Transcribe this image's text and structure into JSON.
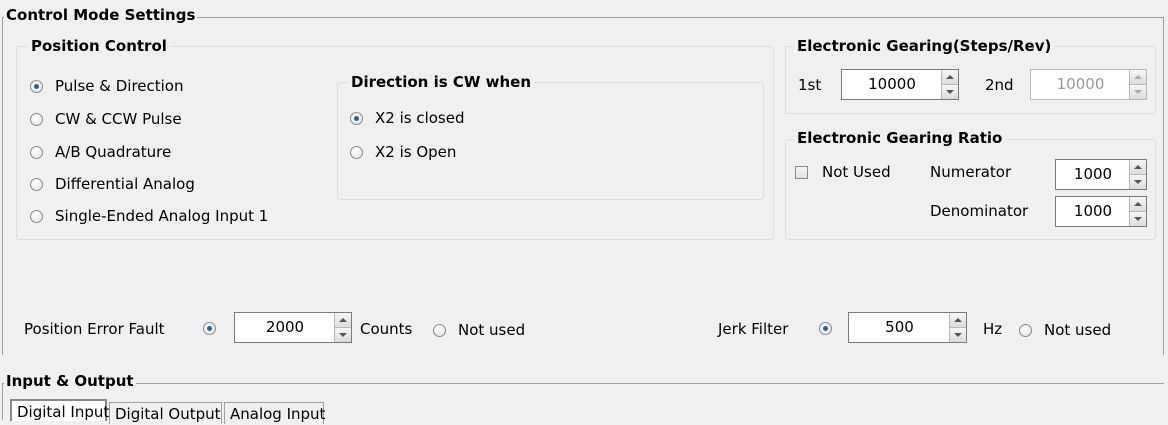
{
  "control_mode": {
    "title": "Control Mode Settings",
    "position_control": {
      "title": "Position Control",
      "modes": [
        {
          "label": "Pulse & Direction",
          "selected": true
        },
        {
          "label": "CW & CCW Pulse",
          "selected": false
        },
        {
          "label": "A/B Quadrature",
          "selected": false
        },
        {
          "label": "Differential Analog",
          "selected": false
        },
        {
          "label": "Single-Ended Analog Input 1",
          "selected": false
        }
      ],
      "direction": {
        "title": "Direction is CW when",
        "options": [
          {
            "label": "X2 is closed",
            "selected": true
          },
          {
            "label": "X2 is Open",
            "selected": false
          }
        ]
      }
    },
    "gearing_steps": {
      "title": "Electronic Gearing(Steps/Rev)",
      "first_label": "1st",
      "first_value": "10000",
      "second_label": "2nd",
      "second_value": "10000"
    },
    "gearing_ratio": {
      "title": "Electronic Gearing Ratio",
      "not_used_label": "Not Used",
      "numerator_label": "Numerator",
      "numerator_value": "1000",
      "denominator_label": "Denominator",
      "denominator_value": "1000"
    },
    "position_error": {
      "label": "Position Error Fault",
      "value": "2000",
      "unit": "Counts",
      "not_used_label": "Not used"
    },
    "jerk_filter": {
      "label": "Jerk Filter",
      "value": "500",
      "unit": "Hz",
      "not_used_label": "Not used"
    }
  },
  "io": {
    "title": "Input & Output",
    "tabs": [
      {
        "label": "Digital Input",
        "active": true
      },
      {
        "label": "Digital Output",
        "active": false
      },
      {
        "label": "Analog Input",
        "active": false
      }
    ]
  }
}
